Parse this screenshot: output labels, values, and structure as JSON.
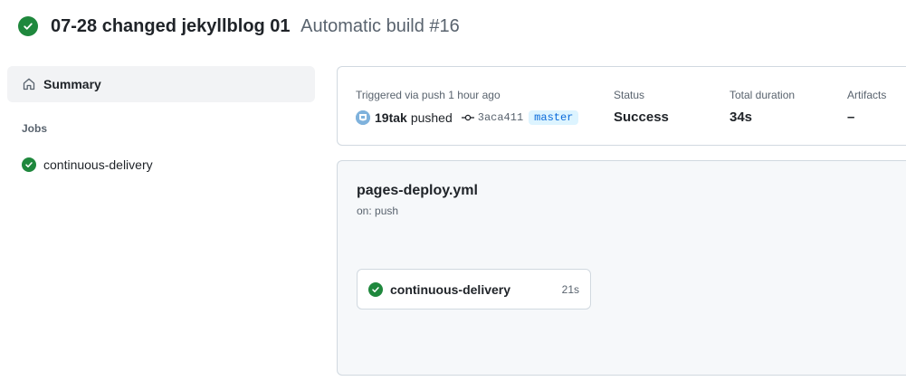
{
  "run": {
    "title": "07-28 changed jekyllblog 01",
    "build_label": "Automatic build #16",
    "status_icon": "check-circle-fill-icon"
  },
  "sidebar": {
    "summary_label": "Summary",
    "summary_icon": "home-icon",
    "jobs_heading": "Jobs",
    "jobs": [
      {
        "label": "continuous-delivery",
        "icon": "check-circle-fill-icon"
      }
    ]
  },
  "info": {
    "trigger_label": "Triggered via push 1 hour ago",
    "user": "19tak",
    "verb": "pushed",
    "commit_icon": "git-commit-icon",
    "sha": "3aca411",
    "branch": "master",
    "status_label": "Status",
    "status_value": "Success",
    "duration_label": "Total duration",
    "duration_value": "34s",
    "artifacts_label": "Artifacts",
    "artifacts_value": "–"
  },
  "workflow": {
    "name": "pages-deploy.yml",
    "on": "on: push",
    "jobs": [
      {
        "name": "continuous-delivery",
        "duration": "21s",
        "icon": "check-circle-fill-icon"
      }
    ]
  },
  "colors": {
    "success": "#1f883d",
    "branch_text": "#0969da",
    "branch_bg": "#ddf4ff",
    "muted": "#59636e"
  }
}
